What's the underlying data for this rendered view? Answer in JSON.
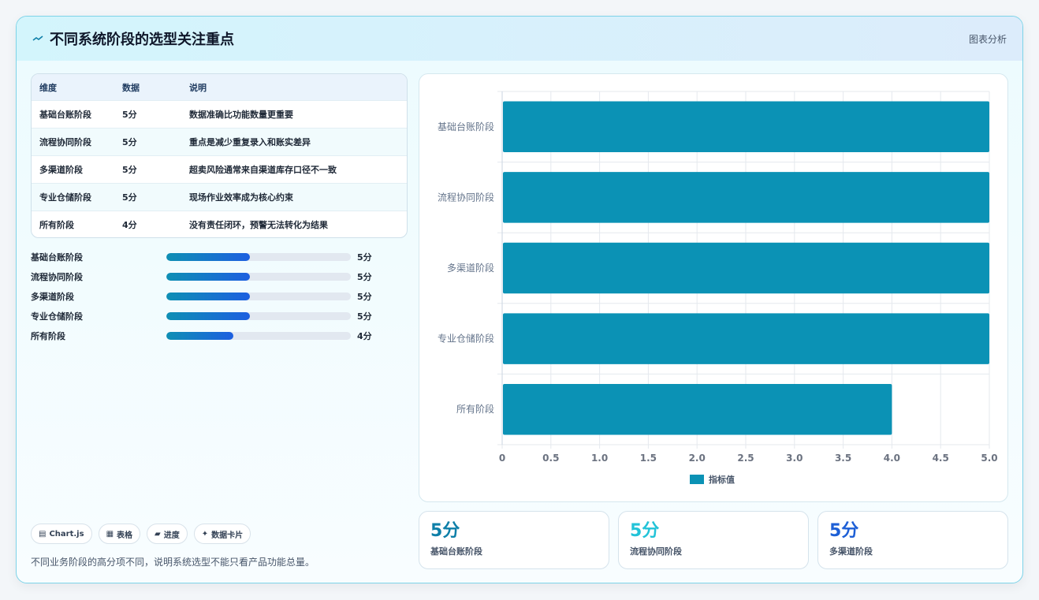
{
  "header": {
    "title": "不同系统阶段的选型关注重点",
    "tag": "图表分析"
  },
  "table": {
    "columns": [
      "维度",
      "数据",
      "说明"
    ],
    "rows": [
      [
        "基础台账阶段",
        "5分",
        "数据准确比功能数量更重要"
      ],
      [
        "流程协同阶段",
        "5分",
        "重点是减少重复录入和账实差异"
      ],
      [
        "多渠道阶段",
        "5分",
        "超卖风险通常来自渠道库存口径不一致"
      ],
      [
        "专业仓储阶段",
        "5分",
        "现场作业效率成为核心约束"
      ],
      [
        "所有阶段",
        "4分",
        "没有责任闭环，预警无法转化为结果"
      ]
    ]
  },
  "progress": [
    {
      "label": "基础台账阶段",
      "value": 5,
      "text": "5分"
    },
    {
      "label": "流程协同阶段",
      "value": 5,
      "text": "5分"
    },
    {
      "label": "多渠道阶段",
      "value": 5,
      "text": "5分"
    },
    {
      "label": "专业仓储阶段",
      "value": 5,
      "text": "5分"
    },
    {
      "label": "所有阶段",
      "value": 4,
      "text": "4分"
    }
  ],
  "progress_max": 11,
  "chips": [
    {
      "icon": "▤",
      "label": "Chart.js"
    },
    {
      "icon": "▦",
      "label": "表格"
    },
    {
      "icon": "▰",
      "label": "进度"
    },
    {
      "icon": "✦",
      "label": "数据卡片"
    }
  ],
  "note": "不同业务阶段的高分项不同，说明系统选型不能只看产品功能总量。",
  "kpis": [
    {
      "value": "5分",
      "label": "基础台账阶段",
      "color": "#0e7fa8"
    },
    {
      "value": "5分",
      "label": "流程协同阶段",
      "color": "#22c3d8"
    },
    {
      "value": "5分",
      "label": "多渠道阶段",
      "color": "#1d5fd6"
    }
  ],
  "chart_data": {
    "type": "bar",
    "orientation": "horizontal",
    "categories": [
      "基础台账阶段",
      "流程协同阶段",
      "多渠道阶段",
      "专业仓储阶段",
      "所有阶段"
    ],
    "series": [
      {
        "name": "指标值",
        "values": [
          5,
          5,
          5,
          5,
          4
        ],
        "color": "#0b92b5"
      }
    ],
    "xlim": [
      0,
      5
    ],
    "xticks": [
      "0",
      "0.5",
      "1.0",
      "1.5",
      "2.0",
      "2.5",
      "3.0",
      "3.5",
      "4.0",
      "4.5",
      "5.0"
    ],
    "grid": true,
    "legend": "bottom"
  }
}
